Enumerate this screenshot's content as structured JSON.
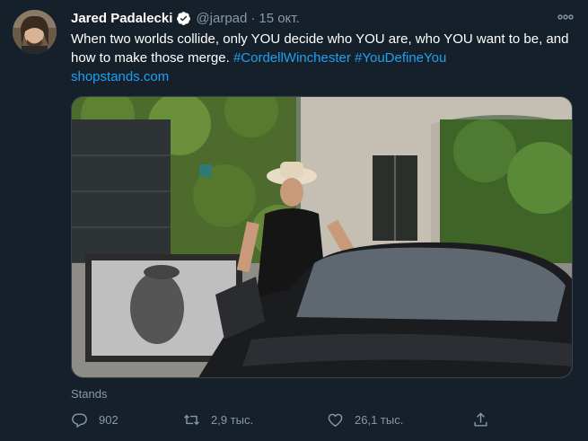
{
  "tweet": {
    "author_name": "Jared Padalecki",
    "handle": "@jarpad",
    "separator": "·",
    "date": "15 окт.",
    "text_plain": "When two worlds collide, only YOU decide who YOU are, who YOU want to be, and how to make those merge. ",
    "hashtag_1": "#CordellWinchester",
    "hashtag_2": "#YouDefineYou",
    "link": "shopstands.com"
  },
  "card": {
    "source": "Stands"
  },
  "actions": {
    "reply_count": "902",
    "retweet_count": "2,9 тыс.",
    "like_count": "26,1 тыс."
  },
  "icons": {
    "verified": "verified-badge-icon",
    "more": "more-dots-icon",
    "reply": "reply-icon",
    "retweet": "retweet-icon",
    "like": "heart-icon",
    "share": "share-icon"
  },
  "colors": {
    "background": "#15202b",
    "accent": "#1da1f2",
    "muted": "#8899a6"
  }
}
